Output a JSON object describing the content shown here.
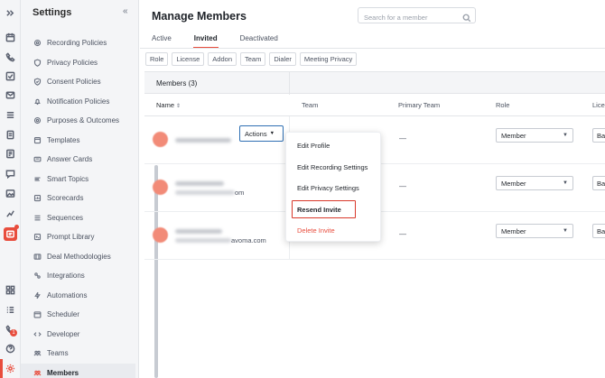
{
  "sidebar": {
    "title": "Settings",
    "collapse_glyph": "«",
    "items": [
      {
        "label": "Recording Policies",
        "icon": "record-icon"
      },
      {
        "label": "Privacy Policies",
        "icon": "shield-icon"
      },
      {
        "label": "Consent Policies",
        "icon": "consent-icon"
      },
      {
        "label": "Notification Policies",
        "icon": "bell-icon"
      },
      {
        "label": "Purposes & Outcomes",
        "icon": "target-icon"
      },
      {
        "label": "Templates",
        "icon": "template-icon"
      },
      {
        "label": "Answer Cards",
        "icon": "card-icon"
      },
      {
        "label": "Smart Topics",
        "icon": "topics-icon"
      },
      {
        "label": "Scorecards",
        "icon": "scorecard-icon"
      },
      {
        "label": "Sequences",
        "icon": "sequence-icon"
      },
      {
        "label": "Prompt Library",
        "icon": "prompt-icon"
      },
      {
        "label": "Deal Methodologies",
        "icon": "methodology-icon"
      },
      {
        "label": "Integrations",
        "icon": "integrations-icon"
      },
      {
        "label": "Automations",
        "icon": "automation-icon"
      },
      {
        "label": "Scheduler",
        "icon": "calendar-icon"
      },
      {
        "label": "Developer",
        "icon": "code-icon"
      },
      {
        "label": "Teams",
        "icon": "teams-icon"
      },
      {
        "label": "Members",
        "icon": "members-icon",
        "active": true
      }
    ]
  },
  "rail": {
    "badge_count": "1"
  },
  "header": {
    "title": "Manage Members",
    "search_placeholder": "Search for a member"
  },
  "tabs": [
    {
      "label": "Active"
    },
    {
      "label": "Invited",
      "active": true
    },
    {
      "label": "Deactivated"
    }
  ],
  "filters": [
    "Role",
    "License",
    "Addon",
    "Team",
    "Dialer",
    "Meeting Privacy"
  ],
  "table": {
    "members_count_label": "Members (3)",
    "headers": {
      "name": "Name",
      "sort_glyph": "⇕",
      "team": "Team",
      "primary_team": "Primary Team",
      "role": "Role",
      "license": "Lice"
    },
    "rows": [
      {
        "email_tail": "",
        "primary_team": "—",
        "role": "Member",
        "license": "Ba"
      },
      {
        "email_tail": "om",
        "primary_team": "—",
        "role": "Member",
        "license": "Ba"
      },
      {
        "email_tail": "avoma.com",
        "primary_team": "—",
        "role": "Member",
        "license": "Ba"
      }
    ],
    "actions_label": "Actions"
  },
  "dropdown": {
    "items": [
      {
        "label": "Edit Profile"
      },
      {
        "label": "Edit Recording Settings"
      },
      {
        "label": "Edit Privacy Settings"
      },
      {
        "label": "Resend Invite",
        "highlighted": true
      },
      {
        "label": "Delete Invite",
        "danger": true
      }
    ]
  },
  "colors": {
    "accent": "#e84d3d",
    "highlight_border": "#d8382a",
    "actions_border": "#2f6fb3"
  }
}
